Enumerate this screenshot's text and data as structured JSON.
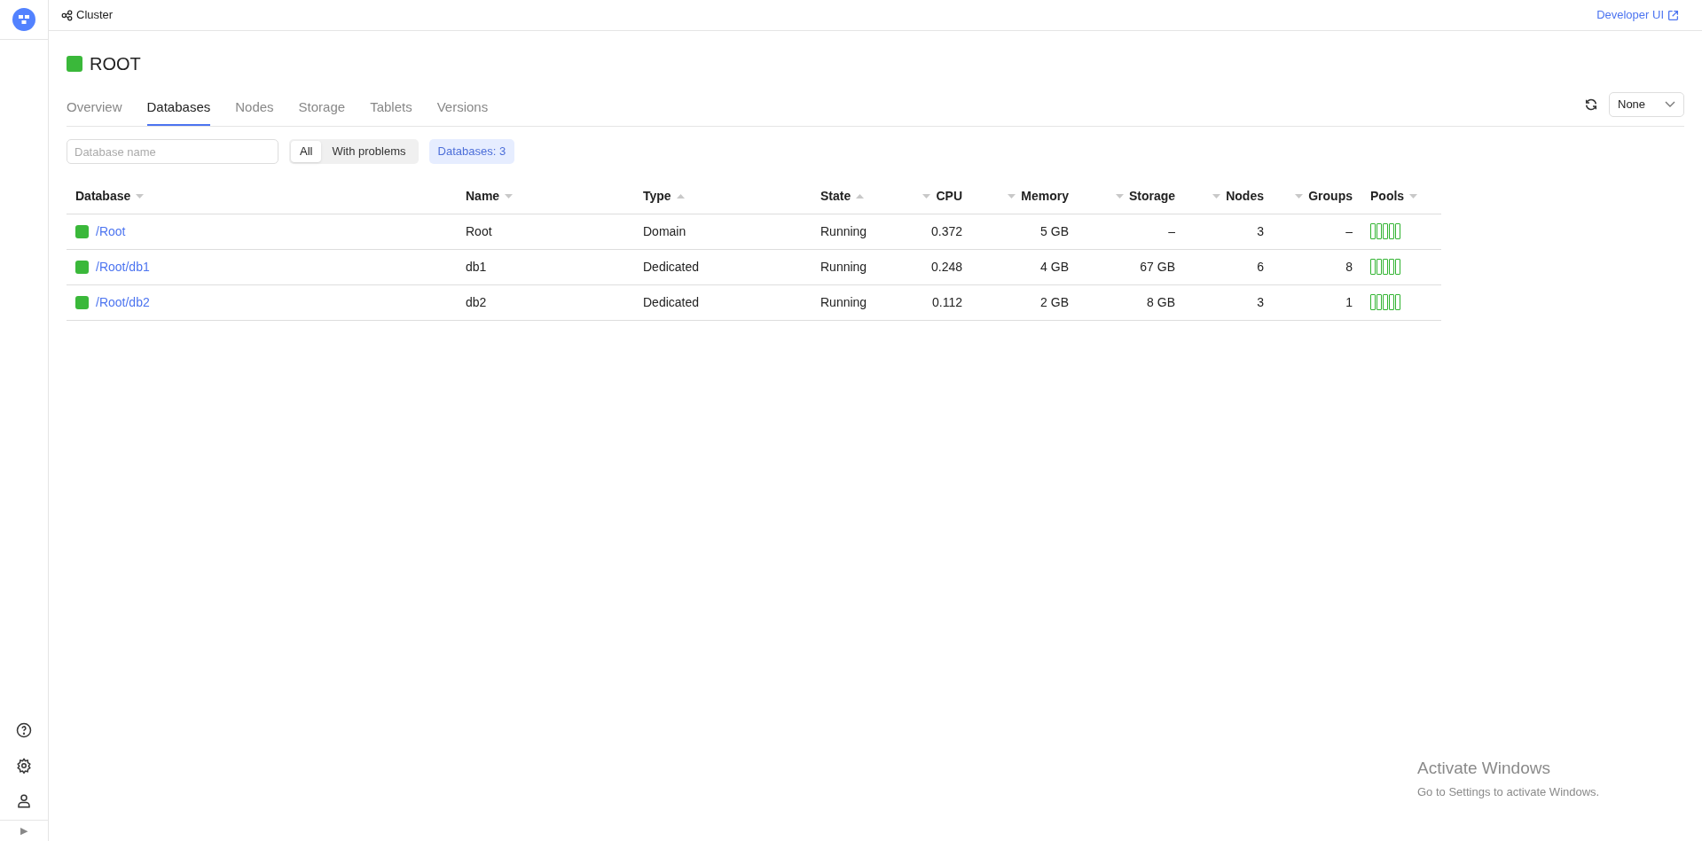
{
  "breadcrumb": {
    "label": "Cluster"
  },
  "header_link": {
    "label": "Developer UI"
  },
  "cluster": {
    "name": "ROOT",
    "color": "#3ab83a"
  },
  "tabs": [
    {
      "label": "Overview",
      "selected": false
    },
    {
      "label": "Databases",
      "selected": true
    },
    {
      "label": "Nodes",
      "selected": false
    },
    {
      "label": "Storage",
      "selected": false
    },
    {
      "label": "Tablets",
      "selected": false
    },
    {
      "label": "Versions",
      "selected": false
    }
  ],
  "refresh_select": {
    "value": "None"
  },
  "search": {
    "placeholder": "Database name"
  },
  "filter": [
    {
      "label": "All",
      "selected": true
    },
    {
      "label": "With problems",
      "selected": false
    }
  ],
  "count_badge": "Databases: 3",
  "table": {
    "columns": [
      {
        "label": "Database",
        "kind": "text",
        "sort_ascending": false
      },
      {
        "label": "Name",
        "kind": "text",
        "sort_ascending": false
      },
      {
        "label": "Type",
        "kind": "text",
        "sort_ascending": true
      },
      {
        "label": "State",
        "kind": "text",
        "sort_ascending": true
      },
      {
        "label": "CPU",
        "kind": "number",
        "sort_ascending": false
      },
      {
        "label": "Memory",
        "kind": "number",
        "sort_ascending": false
      },
      {
        "label": "Storage",
        "kind": "number",
        "sort_ascending": false
      },
      {
        "label": "Nodes",
        "kind": "number",
        "sort_ascending": false
      },
      {
        "label": "Groups",
        "kind": "number",
        "sort_ascending": false
      },
      {
        "label": "Pools",
        "kind": "pools",
        "sort_ascending": false
      }
    ],
    "rows": [
      {
        "color": "#3ab83a",
        "cells": [
          "/Root",
          "Root",
          "Domain",
          "Running",
          "0.372",
          "5 GB",
          "–",
          "3",
          "–"
        ],
        "pools": [
          {
            "level": 0
          },
          {
            "level": 0
          },
          {
            "level": 0
          },
          {
            "level": 0
          },
          {
            "level": 0
          }
        ]
      },
      {
        "color": "#3ab83a",
        "cells": [
          "/Root/db1",
          "db1",
          "Dedicated",
          "Running",
          "0.248",
          "4 GB",
          "67 GB",
          "6",
          "8"
        ],
        "pools": [
          {
            "level": 0
          },
          {
            "level": 0
          },
          {
            "level": 0
          },
          {
            "level": 0
          },
          {
            "level": 0
          }
        ]
      },
      {
        "color": "#3ab83a",
        "cells": [
          "/Root/db2",
          "db2",
          "Dedicated",
          "Running",
          "0.112",
          "2 GB",
          "8 GB",
          "3",
          "1"
        ],
        "pools": [
          {
            "level": 0
          },
          {
            "level": 0
          },
          {
            "level": 0
          },
          {
            "level": 0
          },
          {
            "level": 0
          }
        ]
      }
    ]
  },
  "sidebar_toggle": "▶",
  "os_overlay": {
    "title": "Activate Windows",
    "text": "Go to Settings to activate Windows."
  }
}
